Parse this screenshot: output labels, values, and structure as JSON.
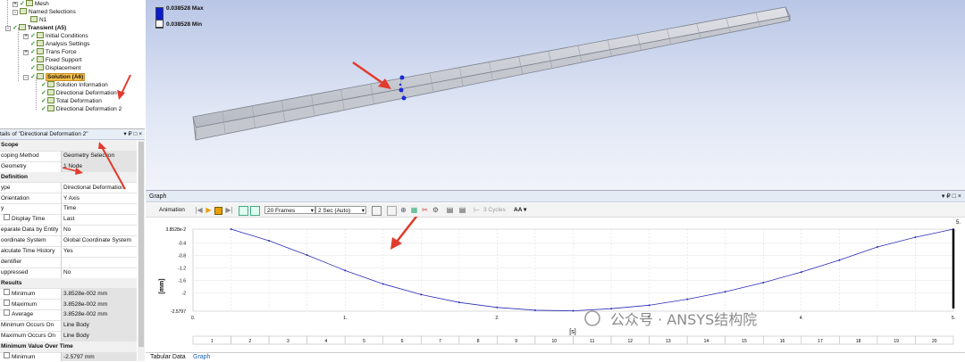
{
  "tree": {
    "items": [
      {
        "label": "Mesh",
        "x": 22,
        "y": 0,
        "icon": "mesh-icon",
        "check": true,
        "pm": "+"
      },
      {
        "label": "Named Selections",
        "x": 22,
        "y": 9,
        "icon": "named-selection-icon",
        "check": false,
        "pm": "-"
      },
      {
        "label": "N1",
        "x": 34,
        "y": 18,
        "icon": "node-selection-icon",
        "check": false
      },
      {
        "label": "Transient (A5)",
        "x": 14,
        "y": 27,
        "icon": "transient-analysis-icon",
        "check": true,
        "pm": "-",
        "bold": true
      },
      {
        "label": "Initial Conditions",
        "x": 34,
        "y": 36,
        "icon": "initial-conditions-icon",
        "check": true,
        "pm": "+"
      },
      {
        "label": "Analysis Settings",
        "x": 34,
        "y": 45,
        "icon": "analysis-settings-icon",
        "check": true
      },
      {
        "label": "Trans Force",
        "x": 34,
        "y": 54,
        "icon": "force-icon",
        "check": true,
        "pm": "+"
      },
      {
        "label": "Fixed Support",
        "x": 34,
        "y": 63,
        "icon": "fixed-support-icon",
        "check": true
      },
      {
        "label": "Displacement",
        "x": 34,
        "y": 72,
        "icon": "displacement-icon",
        "check": true
      },
      {
        "label": "Solution (A6)",
        "x": 34,
        "y": 82,
        "icon": "solution-icon",
        "check": true,
        "pm": "-",
        "highlight": true
      },
      {
        "label": "Solution Information",
        "x": 46,
        "y": 91,
        "icon": "solution-information-icon",
        "check": true
      },
      {
        "label": "Directional Deformation",
        "x": 46,
        "y": 100,
        "icon": "deformation-result-icon",
        "check": true
      },
      {
        "label": "Total Deformation",
        "x": 46,
        "y": 109,
        "icon": "deformation-result-icon",
        "check": true
      },
      {
        "label": "Directional Deformation 2",
        "x": 46,
        "y": 118,
        "icon": "deformation-result-icon",
        "check": true
      }
    ]
  },
  "details": {
    "title": "tails of \"Directional Deformation 2\"",
    "controls": [
      "▾",
      "₽",
      "□",
      "×"
    ],
    "rows": [
      {
        "type": "section",
        "k": "Scope"
      },
      {
        "k": "coping Method",
        "v": "Geometry Selection",
        "gray": true
      },
      {
        "k": "Geometry",
        "v": "1 Node",
        "gray": true
      },
      {
        "type": "section",
        "k": "Definition"
      },
      {
        "k": "ype",
        "v": "Directional Deformation"
      },
      {
        "k": "Orientation",
        "v": "Y Axis"
      },
      {
        "k": "y",
        "v": "Time"
      },
      {
        "k": "Display Time",
        "v": "Last",
        "cb": true
      },
      {
        "k": "eparate Data by Entity",
        "v": "No"
      },
      {
        "k": "oordinate System",
        "v": "Global Coordinate System"
      },
      {
        "k": "alculate Time History",
        "v": "Yes"
      },
      {
        "k": "dentifier",
        "v": ""
      },
      {
        "k": "uppressed",
        "v": "No"
      },
      {
        "type": "section",
        "k": "Results"
      },
      {
        "k": "Minimum",
        "v": "3.8528e-002 mm",
        "cb": true,
        "gray": true
      },
      {
        "k": "Maximum",
        "v": "3.8528e-002 mm",
        "cb": true,
        "gray": true
      },
      {
        "k": "Average",
        "v": "3.8528e-002 mm",
        "cb": true,
        "gray": true
      },
      {
        "k": "Minimum Occurs On",
        "v": "Line Body",
        "gray": true
      },
      {
        "k": "Maximum Occurs On",
        "v": "Line Body",
        "gray": true
      },
      {
        "type": "section",
        "k": "Minimum Value Over Time"
      },
      {
        "k": "Minimum",
        "v": "-2.5797 mm",
        "cb": true,
        "gray": true
      }
    ]
  },
  "viewport": {
    "legend_max": "0.038528 Max",
    "legend_min": "0.038528 Min"
  },
  "graph": {
    "title": "Graph",
    "controls": [
      "▾",
      "₽",
      "□",
      "×"
    ],
    "animation_label": "Animation",
    "frames_value": "20 Frames",
    "time_value": "2 Sec (Auto)",
    "cycles_label": "3 Cycles",
    "aa_label": "AA",
    "ylabel": "[mm]",
    "xlabel": "[s]",
    "top_right_label": "5.",
    "frame_numbers": [
      "1",
      "2",
      "3",
      "4",
      "5",
      "6",
      "7",
      "8",
      "9",
      "10",
      "11",
      "12",
      "13",
      "14",
      "15",
      "16",
      "17",
      "18",
      "19",
      "20"
    ]
  },
  "chart_data": {
    "type": "line",
    "x": [
      0.25,
      0.5,
      0.75,
      1.0,
      1.25,
      1.5,
      1.75,
      2.0,
      2.25,
      2.5,
      2.75,
      3.0,
      3.25,
      3.5,
      3.75,
      4.0,
      4.25,
      4.5,
      4.75,
      5.0
    ],
    "series": [
      {
        "values": [
          0.0385,
          -0.33,
          -0.79,
          -1.28,
          -1.71,
          -2.05,
          -2.3,
          -2.46,
          -2.55,
          -2.57,
          -2.5,
          -2.39,
          -2.2,
          -1.96,
          -1.67,
          -1.33,
          -0.95,
          -0.53,
          -0.22,
          0.0385
        ]
      }
    ],
    "xticks": [
      "0.",
      "1.",
      "2.",
      "3.",
      "4.",
      "5."
    ],
    "yticks": [
      "3.8528e-2",
      "-0.4",
      "-0.8",
      "-1.2",
      "-1.6",
      "-2",
      "-2.5797"
    ],
    "ytick_values": [
      0.0385,
      -0.4,
      -0.8,
      -1.2,
      -1.6,
      -2.0,
      -2.5797
    ],
    "xlim": [
      0,
      5
    ],
    "ylim": [
      -2.5797,
      0.0385
    ],
    "xlabel": "[s]",
    "ylabel": "[mm]",
    "grid": true,
    "color": "#2a2ab8"
  },
  "bottom_tabs": [
    "Tabular Data",
    "Graph"
  ],
  "watermark": "公众号 · ANSYS结构院",
  "colors": {
    "accent": "#f9c04a",
    "legend_blue": "#0b1bd0",
    "arrow_red": "#e23a2d"
  }
}
